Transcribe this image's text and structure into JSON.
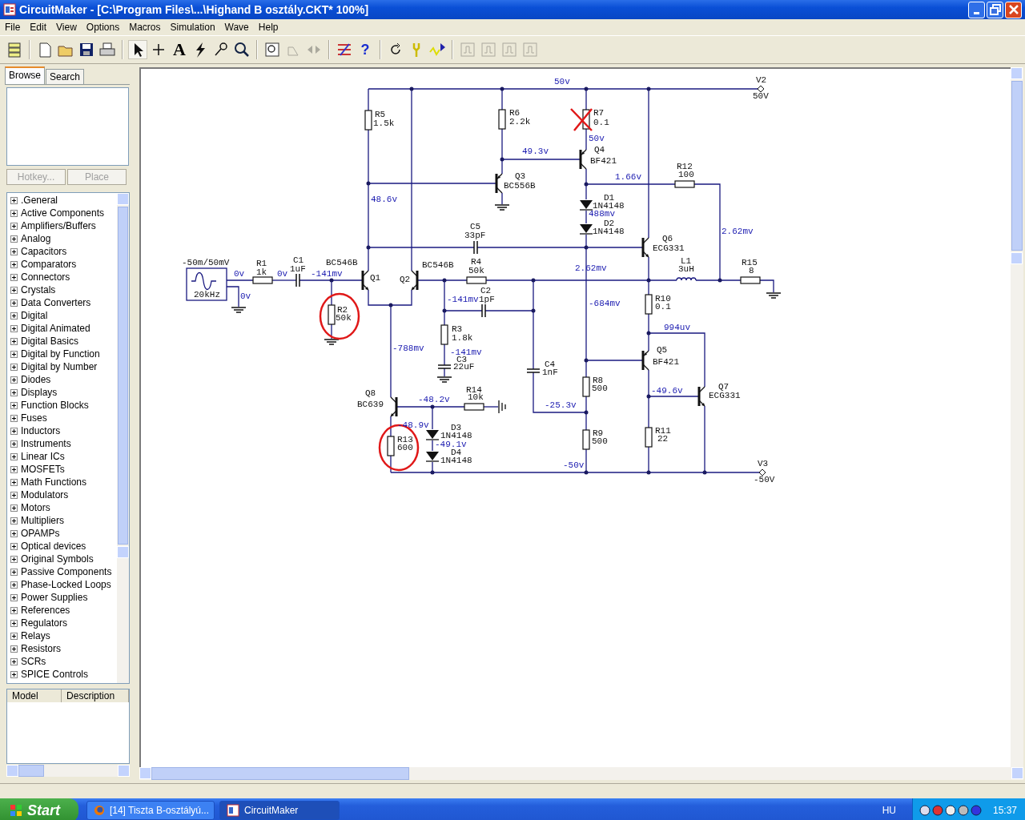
{
  "window": {
    "title": "CircuitMaker - [C:\\Program Files\\...\\Highand B osztály.CKT* 100%]"
  },
  "menu": [
    "File",
    "Edit",
    "View",
    "Options",
    "Macros",
    "Simulation",
    "Wave",
    "Help"
  ],
  "toolbar": [
    {
      "kind": "library",
      "disabled": false
    },
    {
      "kind": "sep"
    },
    {
      "kind": "new",
      "disabled": false
    },
    {
      "kind": "open",
      "disabled": false
    },
    {
      "kind": "save",
      "disabled": false
    },
    {
      "kind": "print",
      "disabled": false
    },
    {
      "kind": "sep"
    },
    {
      "kind": "pointer",
      "disabled": false
    },
    {
      "kind": "wire",
      "disabled": false
    },
    {
      "kind": "text",
      "glyph": "A",
      "disabled": false
    },
    {
      "kind": "probe",
      "disabled": false
    },
    {
      "kind": "wand",
      "disabled": false
    },
    {
      "kind": "zoom",
      "disabled": false
    },
    {
      "kind": "sep"
    },
    {
      "kind": "fit",
      "disabled": false
    },
    {
      "kind": "rotate",
      "disabled": true
    },
    {
      "kind": "mirror",
      "disabled": true
    },
    {
      "kind": "sep"
    },
    {
      "kind": "netlist",
      "disabled": false
    },
    {
      "kind": "help",
      "glyph": "?",
      "disabled": false
    },
    {
      "kind": "sep"
    },
    {
      "kind": "reset",
      "disabled": false
    },
    {
      "kind": "tools",
      "disabled": false
    },
    {
      "kind": "run",
      "disabled": false
    },
    {
      "kind": "sep"
    },
    {
      "kind": "panel",
      "disabled": true
    },
    {
      "kind": "panel",
      "disabled": true
    },
    {
      "kind": "panel",
      "disabled": true
    },
    {
      "kind": "panel",
      "disabled": true
    }
  ],
  "sidebar": {
    "tabs": [
      {
        "label": "Browse",
        "selected": true
      },
      {
        "label": "Search",
        "selected": false
      }
    ],
    "buttons": [
      {
        "label": "Hotkey...",
        "disabled": true
      },
      {
        "label": "Place",
        "disabled": true
      }
    ],
    "libraries": [
      {
        "label": ".General",
        "expanded": false
      },
      {
        "label": "Active Components",
        "expanded": false
      },
      {
        "label": "Amplifiers/Buffers",
        "expanded": false
      },
      {
        "label": "Analog",
        "expanded": false
      },
      {
        "label": "Capacitors",
        "expanded": false
      },
      {
        "label": "Comparators",
        "expanded": false
      },
      {
        "label": "Connectors",
        "expanded": false
      },
      {
        "label": "Crystals",
        "expanded": false
      },
      {
        "label": "Data Converters",
        "expanded": false
      },
      {
        "label": "Digital",
        "expanded": false
      },
      {
        "label": "Digital Animated",
        "expanded": false
      },
      {
        "label": "Digital Basics",
        "expanded": false
      },
      {
        "label": "Digital by Function",
        "expanded": false
      },
      {
        "label": "Digital by Number",
        "expanded": false
      },
      {
        "label": "Diodes",
        "expanded": false
      },
      {
        "label": "Displays",
        "expanded": false
      },
      {
        "label": "Function Blocks",
        "expanded": false
      },
      {
        "label": "Fuses",
        "expanded": false
      },
      {
        "label": "Inductors",
        "expanded": false
      },
      {
        "label": "Instruments",
        "expanded": false
      },
      {
        "label": "Linear ICs",
        "expanded": false
      },
      {
        "label": "MOSFETs",
        "expanded": false
      },
      {
        "label": "Math Functions",
        "expanded": false
      },
      {
        "label": "Modulators",
        "expanded": false
      },
      {
        "label": "Motors",
        "expanded": false
      },
      {
        "label": "Multipliers",
        "expanded": false
      },
      {
        "label": "OPAMPs",
        "expanded": false
      },
      {
        "label": "Optical devices",
        "expanded": false
      },
      {
        "label": "Original Symbols",
        "expanded": false
      },
      {
        "label": "Passive Components",
        "expanded": false
      },
      {
        "label": "Phase-Locked Loops",
        "expanded": false
      },
      {
        "label": "Power Supplies",
        "expanded": false
      },
      {
        "label": "References",
        "expanded": false
      },
      {
        "label": "Regulators",
        "expanded": false
      },
      {
        "label": "Relays",
        "expanded": false
      },
      {
        "label": "Resistors",
        "expanded": false
      },
      {
        "label": "SCRs",
        "expanded": false
      },
      {
        "label": "SPICE Controls",
        "expanded": false
      }
    ],
    "model_table": {
      "columns": [
        "Model",
        "Description"
      ]
    }
  },
  "schematic": {
    "components": [
      {
        "kind": "resistor",
        "ref": "R5",
        "value": "1.5k",
        "circled": false,
        "crossed": false
      },
      {
        "kind": "resistor",
        "ref": "R6",
        "value": "2.2k",
        "circled": false,
        "crossed": false
      },
      {
        "kind": "resistor",
        "ref": "R7",
        "value": "0.1",
        "circled": false,
        "crossed": true
      },
      {
        "kind": "supply",
        "ref": "V2",
        "value": "50V",
        "circled": false,
        "crossed": false
      },
      {
        "kind": "pnp",
        "ref": "Q4",
        "value": "BF421",
        "circled": false,
        "crossed": false
      },
      {
        "kind": "pnp",
        "ref": "Q3",
        "value": "BC556B",
        "circled": false,
        "crossed": false
      },
      {
        "kind": "resistor",
        "ref": "R12",
        "value": "100",
        "circled": false,
        "crossed": false
      },
      {
        "kind": "diode",
        "ref": "D1",
        "value": "1N4148",
        "circled": false,
        "crossed": false
      },
      {
        "kind": "diode",
        "ref": "D2",
        "value": "1N4148",
        "circled": false,
        "crossed": false
      },
      {
        "kind": "capacitor",
        "ref": "C5",
        "value": "33pF",
        "circled": false,
        "crossed": false
      },
      {
        "kind": "npn",
        "ref": "Q6",
        "value": "ECG331",
        "circled": false,
        "crossed": false
      },
      {
        "kind": "signal_source",
        "value": "-50m/50mV",
        "frequency": "20kHz",
        "circled": false,
        "crossed": false
      },
      {
        "kind": "resistor",
        "ref": "R1",
        "value": "1k",
        "circled": false,
        "crossed": false
      },
      {
        "kind": "capacitor",
        "ref": "C1",
        "value": "1uF",
        "circled": false,
        "crossed": false
      },
      {
        "kind": "npn",
        "ref": "Q1",
        "value": "BC546B",
        "circled": false,
        "crossed": false
      },
      {
        "kind": "npn",
        "ref": "Q2",
        "value": "BC546B",
        "circled": false,
        "crossed": false
      },
      {
        "kind": "resistor",
        "ref": "R4",
        "value": "50k",
        "circled": false,
        "crossed": false
      },
      {
        "kind": "inductor",
        "ref": "L1",
        "value": "3uH",
        "circled": false,
        "crossed": false
      },
      {
        "kind": "resistor",
        "ref": "R15",
        "value": "8",
        "circled": false,
        "crossed": false
      },
      {
        "kind": "resistor",
        "ref": "R2",
        "value": "50k",
        "circled": true,
        "crossed": false
      },
      {
        "kind": "capacitor",
        "ref": "C2",
        "value": "1pF",
        "circled": false,
        "crossed": false
      },
      {
        "kind": "resistor",
        "ref": "R10",
        "value": "0.1",
        "circled": false,
        "crossed": false
      },
      {
        "kind": "resistor",
        "ref": "R3",
        "value": "1.8k",
        "circled": false,
        "crossed": false
      },
      {
        "kind": "capacitor",
        "ref": "C3",
        "value": "22uF",
        "circled": false,
        "crossed": false
      },
      {
        "kind": "pnp",
        "ref": "Q5",
        "value": "BF421",
        "circled": false,
        "crossed": false
      },
      {
        "kind": "capacitor",
        "ref": "C4",
        "value": "1nF",
        "circled": false,
        "crossed": false
      },
      {
        "kind": "resistor",
        "ref": "R8",
        "value": "500",
        "circled": false,
        "crossed": false
      },
      {
        "kind": "npn",
        "ref": "Q8",
        "value": "BC639",
        "circled": false,
        "crossed": false
      },
      {
        "kind": "resistor",
        "ref": "R14",
        "value": "10k",
        "circled": false,
        "crossed": false
      },
      {
        "kind": "npn",
        "ref": "Q7",
        "value": "ECG331",
        "circled": false,
        "crossed": false
      },
      {
        "kind": "resistor",
        "ref": "R13",
        "value": "600",
        "circled": true,
        "crossed": false
      },
      {
        "kind": "diode",
        "ref": "D3",
        "value": "1N4148",
        "circled": false,
        "crossed": false
      },
      {
        "kind": "resistor",
        "ref": "R9",
        "value": "500",
        "circled": false,
        "crossed": false
      },
      {
        "kind": "resistor",
        "ref": "R11",
        "value": "22",
        "circled": false,
        "crossed": false
      },
      {
        "kind": "diode",
        "ref": "D4",
        "value": "1N4148",
        "circled": false,
        "crossed": false
      },
      {
        "kind": "supply",
        "ref": "V3",
        "value": "-50V",
        "circled": false,
        "crossed": false
      }
    ],
    "readings": [
      "50v",
      "49.3v",
      "50v",
      "1.66v",
      "48.6v",
      "488mv",
      "2.62mv",
      "0v",
      "0v",
      "-141mv",
      "2.62mv",
      "0v",
      "-141mv",
      "-684mv",
      "994uv",
      "-788mv",
      "-141mv",
      "-48.2v",
      "-49.6v",
      "-25.3v",
      "-48.9v",
      "-49.1v",
      "-50v"
    ]
  },
  "taskbar": {
    "start": "Start",
    "tasks": [
      {
        "label": "[14] Tiszta B-osztályú...",
        "selected": false
      },
      {
        "label": "CircuitMaker",
        "selected": true
      }
    ],
    "language": "HU",
    "clock": "15:37"
  }
}
